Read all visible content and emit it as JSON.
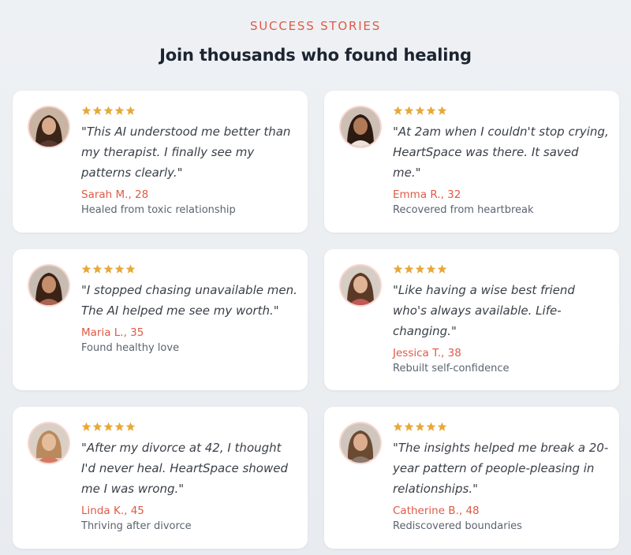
{
  "section": {
    "eyebrow": "SUCCESS STORIES",
    "headline": "Join thousands who found healing"
  },
  "colors": {
    "accent": "#e05a47",
    "star": "#e6a93a",
    "card_bg": "#ffffff",
    "page_bg": "#eceff2"
  },
  "testimonials": [
    {
      "rating": 5,
      "quote": "\"This AI understood me better than my therapist. I finally see my patterns clearly.\"",
      "author": "Sarah M., 28",
      "outcome": "Healed from toxic relationship"
    },
    {
      "rating": 5,
      "quote": "\"At 2am when I couldn't stop crying, HeartSpace was there. It saved me.\"",
      "author": "Emma R., 32",
      "outcome": "Recovered from heartbreak"
    },
    {
      "rating": 5,
      "quote": "\"I stopped chasing unavailable men. The AI helped me see my worth.\"",
      "author": "Maria L., 35",
      "outcome": "Found healthy love"
    },
    {
      "rating": 5,
      "quote": "\"Like having a wise best friend who's always available. Life-changing.\"",
      "author": "Jessica T., 38",
      "outcome": "Rebuilt self-confidence"
    },
    {
      "rating": 5,
      "quote": "\"After my divorce at 42, I thought I'd never heal. HeartSpace showed me I was wrong.\"",
      "author": "Linda K., 45",
      "outcome": "Thriving after divorce"
    },
    {
      "rating": 5,
      "quote": "\"The insights helped me break a 20-year pattern of people-pleasing in relationships.\"",
      "author": "Catherine B., 48",
      "outcome": "Rediscovered boundaries"
    }
  ]
}
